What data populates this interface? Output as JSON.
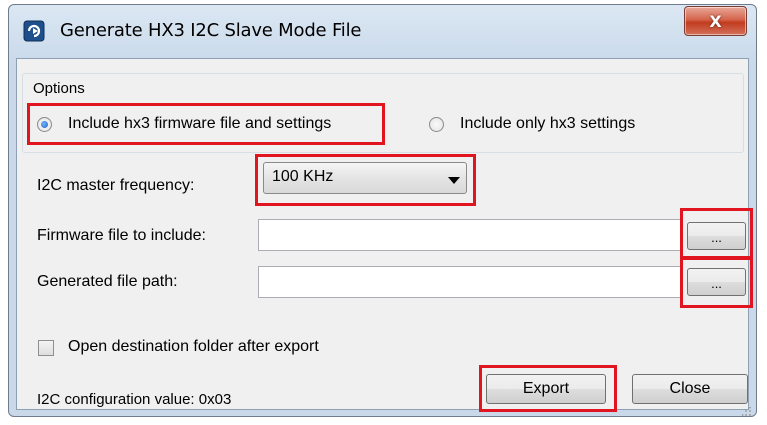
{
  "window": {
    "title": "Generate HX3 I2C Slave Mode File",
    "close_glyph": "X"
  },
  "options": {
    "legend": "Options",
    "radio_full": {
      "label": "Include hx3 firmware file and settings",
      "checked": true
    },
    "radio_settings_only": {
      "label": "Include only hx3 settings",
      "checked": false
    }
  },
  "frequency": {
    "label": "I2C master frequency:",
    "selected": "100 KHz"
  },
  "firmware": {
    "label": "Firmware file to include:",
    "value": "",
    "browse_label": "..."
  },
  "output": {
    "label": "Generated file path:",
    "value": "",
    "browse_label": "..."
  },
  "open_folder": {
    "label": "Open destination folder after export",
    "checked": false
  },
  "status": {
    "config_value": "I2C configuration value: 0x03"
  },
  "buttons": {
    "export": "Export",
    "close": "Close"
  },
  "colors": {
    "highlight": "#e0151f",
    "client_bg": "#f0f0f0",
    "close_button": "#c13c1f"
  }
}
